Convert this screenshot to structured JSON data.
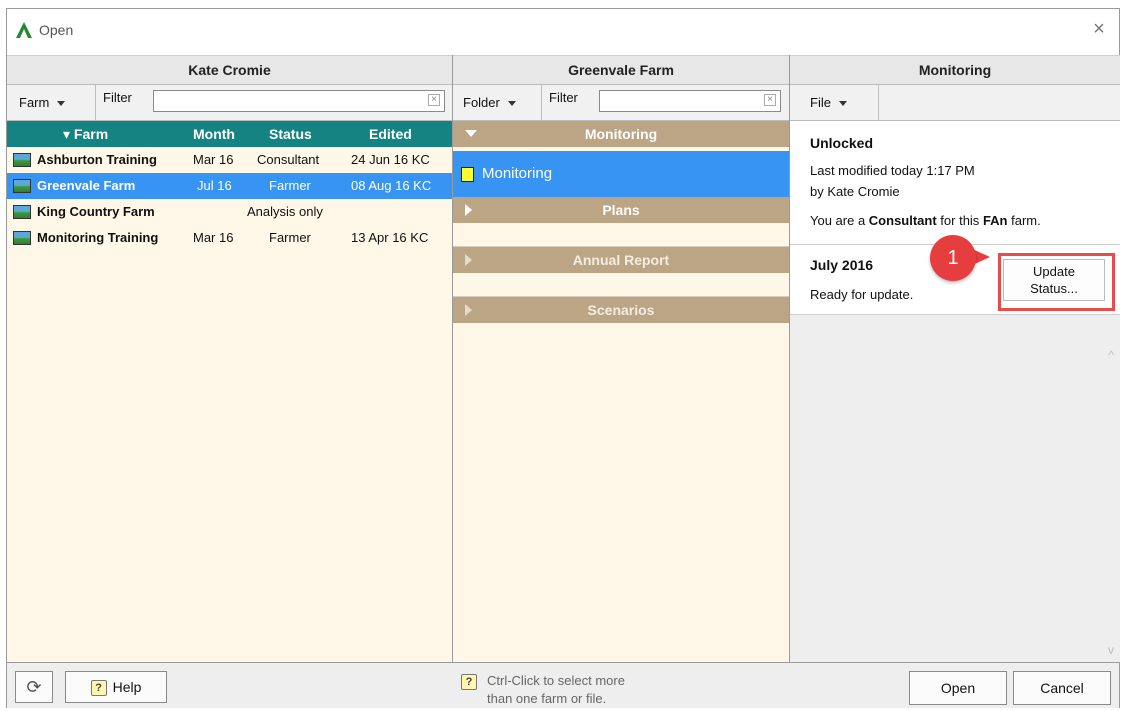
{
  "window": {
    "title": "Open",
    "close_glyph": "×"
  },
  "accent_colors": {
    "teal": "#168383",
    "selection": "#3794f2",
    "folder": "#bba584",
    "annotation": "#e63e3e"
  },
  "left": {
    "header": "Kate Cromie",
    "dropdown": "Farm",
    "filter_label": "Filter",
    "filter_value": "",
    "table_headers": {
      "farm": "▾ Farm",
      "month": "Month",
      "status": "Status",
      "edited": "Edited"
    },
    "rows": [
      {
        "farm": "Ashburton Training",
        "month": "Mar 16",
        "status": "Consultant",
        "edited": "24 Jun 16 KC",
        "selected": false
      },
      {
        "farm": "Greenvale Farm",
        "month": "Jul 16",
        "status": "Farmer",
        "edited": "08 Aug 16 KC",
        "selected": true
      },
      {
        "farm": "King Country Farm",
        "month": "",
        "status": "Analysis only",
        "edited": "",
        "selected": false
      },
      {
        "farm": "Monitoring Training",
        "month": "Mar 16",
        "status": "Farmer",
        "edited": "13 Apr 16 KC",
        "selected": false
      }
    ]
  },
  "middle": {
    "header": "Greenvale Farm",
    "dropdown": "Folder",
    "filter_label": "Filter",
    "filter_value": "",
    "folders": [
      {
        "label": "Monitoring",
        "expanded": true
      },
      {
        "label": "Plans",
        "expanded": false
      },
      {
        "label": "Annual Report",
        "expanded": false
      },
      {
        "label": "Scenarios",
        "expanded": false
      }
    ],
    "files": [
      "Monitoring"
    ]
  },
  "right": {
    "header": "Monitoring",
    "dropdown": "File",
    "lock_status": "Unlocked",
    "last_modified": "Last modified today 1:17 PM",
    "modified_by": "by Kate Cromie",
    "role_prefix": "You are a ",
    "role": "Consultant",
    "role_middle": " for this ",
    "product": "FAn",
    "role_suffix": " farm.",
    "period": "July 2016",
    "period_status": "Ready for update.",
    "update_button_line1": "Update",
    "update_button_line2": "Status...",
    "annotation_number": "1"
  },
  "footer": {
    "refresh_glyph": "⟳",
    "help_label": "Help",
    "hint_line1": "Ctrl-Click to select more",
    "hint_line2": "than one farm or file.",
    "open_label": "Open",
    "cancel_label": "Cancel"
  }
}
